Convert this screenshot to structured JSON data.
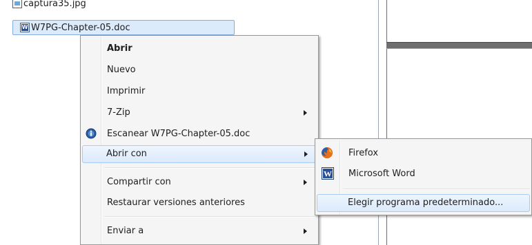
{
  "files": [
    {
      "name": "captura35.jpg",
      "type": "image"
    },
    {
      "name": "W7PG-Chapter-05.doc",
      "type": "word",
      "selected": true
    }
  ],
  "context_menu": {
    "items": [
      {
        "label": "Abrir",
        "bold": true
      },
      {
        "label": "Nuevo"
      },
      {
        "label": "Imprimir"
      },
      {
        "label": "7-Zip",
        "submenu": true
      },
      {
        "label": "Escanear W7PG-Chapter-05.doc",
        "icon": "antivirus-scan-icon"
      },
      {
        "label": "Abrir con",
        "submenu": true,
        "highlighted": true
      },
      {
        "label": "Compartir con",
        "submenu": true
      },
      {
        "label": "Restaurar versiones anteriores"
      },
      {
        "label": "Enviar a",
        "submenu": true
      }
    ]
  },
  "open_with_menu": {
    "items": [
      {
        "label": "Firefox",
        "icon": "firefox-icon"
      },
      {
        "label": "Microsoft Word",
        "icon": "word-icon"
      },
      {
        "label": "Elegir programa predeterminado...",
        "highlighted": true
      }
    ]
  },
  "colors": {
    "selection_fill": "#dcebfc",
    "selection_border": "#84acdd",
    "menu_background": "#f5f5f5",
    "hover_border": "#a8cbf1"
  }
}
